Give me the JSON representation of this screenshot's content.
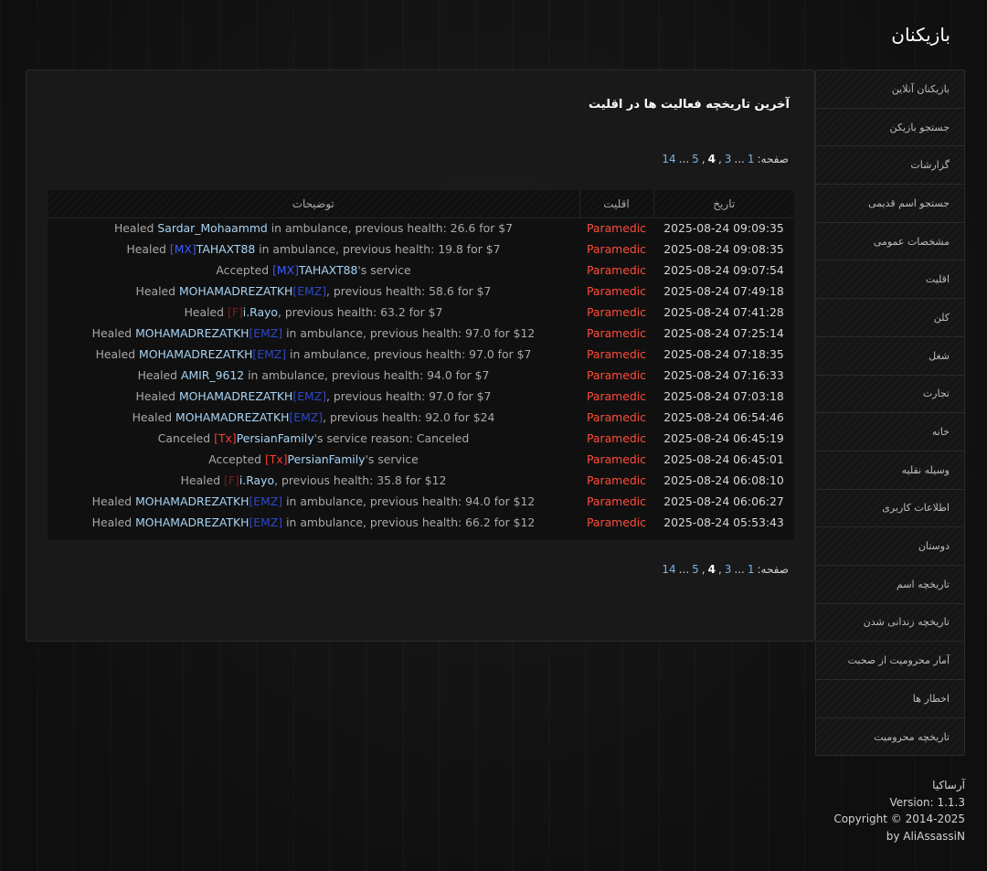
{
  "page_title": "بازیکنان",
  "sidebar": {
    "items": [
      {
        "label": "بازیکنان آنلاین"
      },
      {
        "label": "جستجو بازیکن"
      },
      {
        "label": "گزارشات"
      },
      {
        "label": "جستجو اسم قدیمی"
      },
      {
        "label": "مشخصات عمومی"
      },
      {
        "label": "اقلیت"
      },
      {
        "label": "کلن"
      },
      {
        "label": "شغل"
      },
      {
        "label": "تجارت"
      },
      {
        "label": "خانه"
      },
      {
        "label": "وسیله نقلیه"
      },
      {
        "label": "اطلاعات کاربری"
      },
      {
        "label": "دوستان"
      },
      {
        "label": "تاریخچه اسم"
      },
      {
        "label": "تاریخچه زندانی شدن"
      },
      {
        "label": "آمار محرومیت از صحبت"
      },
      {
        "label": "اخطار ها"
      },
      {
        "label": "تاریخچه محرومیت"
      }
    ]
  },
  "panel": {
    "heading": "آخرین تاریخچه فعالیت ها در اقلیت"
  },
  "pagination": {
    "label": "صفحه:",
    "p1": "1",
    "ellipsis1": "...",
    "p3": "3",
    "comma1": ",",
    "p4": "4",
    "comma2": ",",
    "p5": "5",
    "ellipsis2": "...",
    "p14": "14"
  },
  "table": {
    "headers": {
      "date": "تاریخ",
      "faction": "اقلیت",
      "description": "توضیحات"
    },
    "rows": [
      {
        "date": "2025-08-24 09:09:35",
        "faction": "Paramedic",
        "parts": [
          {
            "t": "Healed "
          },
          {
            "t": "Sardar_Mohaammd",
            "c": "p-name"
          },
          {
            "t": " in ambulance, previous health: 26.6 for $7"
          }
        ]
      },
      {
        "date": "2025-08-24 09:08:35",
        "faction": "Paramedic",
        "parts": [
          {
            "t": "Healed "
          },
          {
            "t": "[MX]",
            "c": "t-mx"
          },
          {
            "t": "TAHAXT88",
            "c": "p-name"
          },
          {
            "t": " in ambulance, previous health: 19.8 for $7"
          }
        ]
      },
      {
        "date": "2025-08-24 09:07:54",
        "faction": "Paramedic",
        "parts": [
          {
            "t": "Accepted "
          },
          {
            "t": "[MX]",
            "c": "t-mx"
          },
          {
            "t": "TAHAXT88",
            "c": "p-name"
          },
          {
            "t": "'s service"
          }
        ]
      },
      {
        "date": "2025-08-24 07:49:18",
        "faction": "Paramedic",
        "parts": [
          {
            "t": "Healed "
          },
          {
            "t": "MOHAMADREZATKH",
            "c": "p-name"
          },
          {
            "t": "[EMZ]",
            "c": "t-emz"
          },
          {
            "t": ", previous health: 58.6 for $7"
          }
        ]
      },
      {
        "date": "2025-08-24 07:41:28",
        "faction": "Paramedic",
        "parts": [
          {
            "t": "Healed "
          },
          {
            "t": "[F]",
            "c": "t-f"
          },
          {
            "t": "i.Rayo",
            "c": "p-name"
          },
          {
            "t": ", previous health: 63.2 for $7"
          }
        ]
      },
      {
        "date": "2025-08-24 07:25:14",
        "faction": "Paramedic",
        "parts": [
          {
            "t": "Healed "
          },
          {
            "t": "MOHAMADREZATKH",
            "c": "p-name"
          },
          {
            "t": "[EMZ]",
            "c": "t-emz"
          },
          {
            "t": " in ambulance, previous health: 97.0 for $12"
          }
        ]
      },
      {
        "date": "2025-08-24 07:18:35",
        "faction": "Paramedic",
        "parts": [
          {
            "t": "Healed "
          },
          {
            "t": "MOHAMADREZATKH",
            "c": "p-name"
          },
          {
            "t": "[EMZ]",
            "c": "t-emz"
          },
          {
            "t": " in ambulance, previous health: 97.0 for $7"
          }
        ]
      },
      {
        "date": "2025-08-24 07:16:33",
        "faction": "Paramedic",
        "parts": [
          {
            "t": "Healed "
          },
          {
            "t": "AMIR_9612",
            "c": "p-name"
          },
          {
            "t": " in ambulance, previous health: 94.0 for $7"
          }
        ]
      },
      {
        "date": "2025-08-24 07:03:18",
        "faction": "Paramedic",
        "parts": [
          {
            "t": "Healed "
          },
          {
            "t": "MOHAMADREZATKH",
            "c": "p-name"
          },
          {
            "t": "[EMZ]",
            "c": "t-emz"
          },
          {
            "t": ", previous health: 97.0 for $7"
          }
        ]
      },
      {
        "date": "2025-08-24 06:54:46",
        "faction": "Paramedic",
        "parts": [
          {
            "t": "Healed "
          },
          {
            "t": "MOHAMADREZATKH",
            "c": "p-name"
          },
          {
            "t": "[EMZ]",
            "c": "t-emz"
          },
          {
            "t": ", previous health: 92.0 for $24"
          }
        ]
      },
      {
        "date": "2025-08-24 06:45:19",
        "faction": "Paramedic",
        "parts": [
          {
            "t": "Canceled "
          },
          {
            "t": "[Tx]",
            "c": "t-tx"
          },
          {
            "t": "PersianFamily",
            "c": "p-name"
          },
          {
            "t": "'s service reason: Canceled"
          }
        ]
      },
      {
        "date": "2025-08-24 06:45:01",
        "faction": "Paramedic",
        "parts": [
          {
            "t": "Accepted "
          },
          {
            "t": "[Tx]",
            "c": "t-tx"
          },
          {
            "t": "PersianFamily",
            "c": "p-name"
          },
          {
            "t": "'s service"
          }
        ]
      },
      {
        "date": "2025-08-24 06:08:10",
        "faction": "Paramedic",
        "parts": [
          {
            "t": "Healed "
          },
          {
            "t": "[F]",
            "c": "t-f"
          },
          {
            "t": "i.Rayo",
            "c": "p-name"
          },
          {
            "t": ", previous health: 35.8 for $12"
          }
        ]
      },
      {
        "date": "2025-08-24 06:06:27",
        "faction": "Paramedic",
        "parts": [
          {
            "t": "Healed "
          },
          {
            "t": "MOHAMADREZATKH",
            "c": "p-name"
          },
          {
            "t": "[EMZ]",
            "c": "t-emz"
          },
          {
            "t": " in ambulance, previous health: 94.0 for $12"
          }
        ]
      },
      {
        "date": "2025-08-24 05:53:43",
        "faction": "Paramedic",
        "parts": [
          {
            "t": "Healed "
          },
          {
            "t": "MOHAMADREZATKH",
            "c": "p-name"
          },
          {
            "t": "[EMZ]",
            "c": "t-emz"
          },
          {
            "t": " in ambulance, previous health: 66.2 for $12"
          }
        ]
      }
    ]
  },
  "footer": {
    "site": "آرساکیا",
    "version": "Version: 1.1.3",
    "copyright": "Copyright © 2014-2025",
    "author": "by AliAssassiN"
  },
  "colors": {
    "faction": "#ff4d3a",
    "player_name": "#a8d4f5",
    "tag_mx": "#3b5bff",
    "tag_emz": "#2d49c9",
    "tag_tx": "#ff3b2f",
    "tag_f": "#8a1a1a",
    "pager_link": "#7fb3df"
  }
}
